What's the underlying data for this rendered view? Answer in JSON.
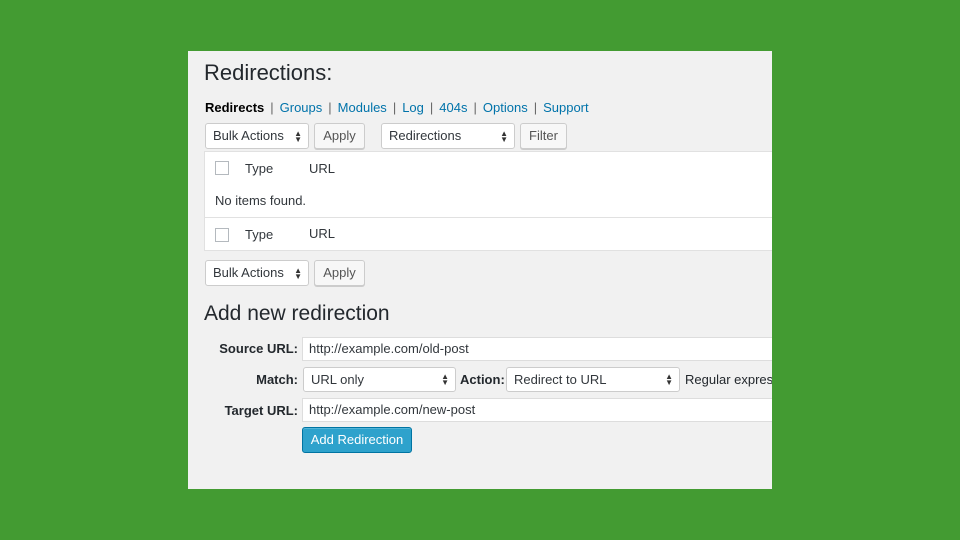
{
  "page": {
    "title": "Redirections:",
    "nav": {
      "current": "Redirects",
      "links": [
        "Groups",
        "Modules",
        "Log",
        "404s",
        "Options",
        "Support"
      ],
      "separator": "|"
    }
  },
  "toolbar_top": {
    "bulk_actions": "Bulk Actions",
    "apply": "Apply",
    "group_filter": "Redirections",
    "filter": "Filter"
  },
  "table": {
    "columns": {
      "type": "Type",
      "url": "URL"
    },
    "empty_message": "No items found."
  },
  "toolbar_bottom": {
    "bulk_actions": "Bulk Actions",
    "apply": "Apply"
  },
  "add_form": {
    "heading": "Add new redirection",
    "source_label": "Source URL:",
    "source_value": "http://example.com/old-post",
    "match_label": "Match:",
    "match_value": "URL only",
    "action_label": "Action:",
    "action_value": "Redirect to URL",
    "regex_label": "Regular express",
    "target_label": "Target URL:",
    "target_value": "http://example.com/new-post",
    "submit": "Add Redirection"
  },
  "colors": {
    "background": "#439b32",
    "panel": "#f1f1f1",
    "link": "#0073aa",
    "primary_button": "#2ea2cc"
  },
  "icons": {
    "select_arrow": "up-down-arrows-icon"
  }
}
